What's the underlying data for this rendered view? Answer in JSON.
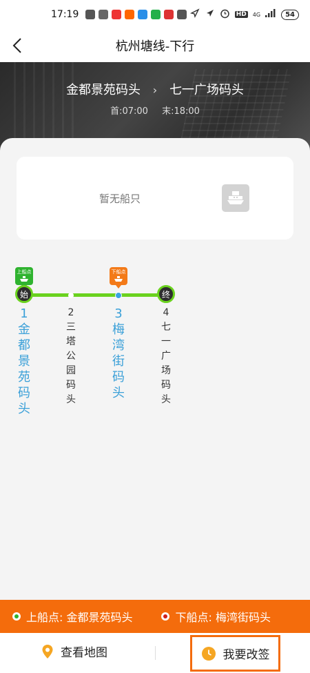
{
  "status_bar": {
    "time": "17:19",
    "network": "4G",
    "battery": "54"
  },
  "nav": {
    "title": "杭州塘线-下行"
  },
  "route": {
    "from": "金都景苑码头",
    "to": "七一广场码头",
    "first_time": "首:07:00",
    "last_time": "末:18:00"
  },
  "ship_card": {
    "empty_text": "暂无船只"
  },
  "stops": [
    {
      "num": "1",
      "name": "金都景苑码头",
      "badge": "始",
      "flag": "上船点"
    },
    {
      "num": "2",
      "name": "三塔公园码头"
    },
    {
      "num": "3",
      "name": "梅湾街码头",
      "flag": "下船点"
    },
    {
      "num": "4",
      "name": "七一广场码头",
      "badge": "终"
    }
  ],
  "info_bar": {
    "board_label": "上船点: 金都景苑码头",
    "alight_label": "下船点: 梅湾街码头"
  },
  "actions": {
    "map_label": "查看地图",
    "change_label": "我要改签"
  },
  "colors": {
    "accent_orange": "#f46c0c",
    "track_green": "#6ad21e",
    "highlight_blue": "#3ba0d8",
    "board_green": "#2fb32f"
  }
}
